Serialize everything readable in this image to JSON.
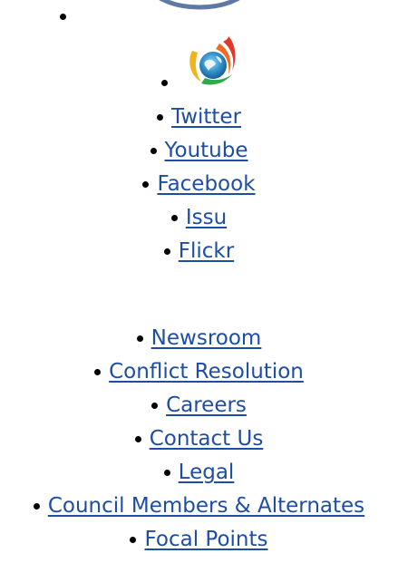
{
  "colors": {
    "link": "#1e4da6",
    "bullet": "#000000",
    "logo_ring": "#5e79a6"
  },
  "icons": {
    "top_logo": "circle-logo-icon",
    "emblem": "globe-flame-emblem-icon"
  },
  "social_links": [
    {
      "label": "Twitter"
    },
    {
      "label": "Youtube"
    },
    {
      "label": "Facebook"
    },
    {
      "label": "Issu"
    },
    {
      "label": "Flickr"
    }
  ],
  "footer_links": [
    {
      "label": "Newsroom"
    },
    {
      "label": "Conflict Resolution"
    },
    {
      "label": "Careers"
    },
    {
      "label": "Contact Us"
    },
    {
      "label": "Legal"
    },
    {
      "label": "Council Members & Alternates"
    },
    {
      "label": "Focal Points"
    }
  ]
}
